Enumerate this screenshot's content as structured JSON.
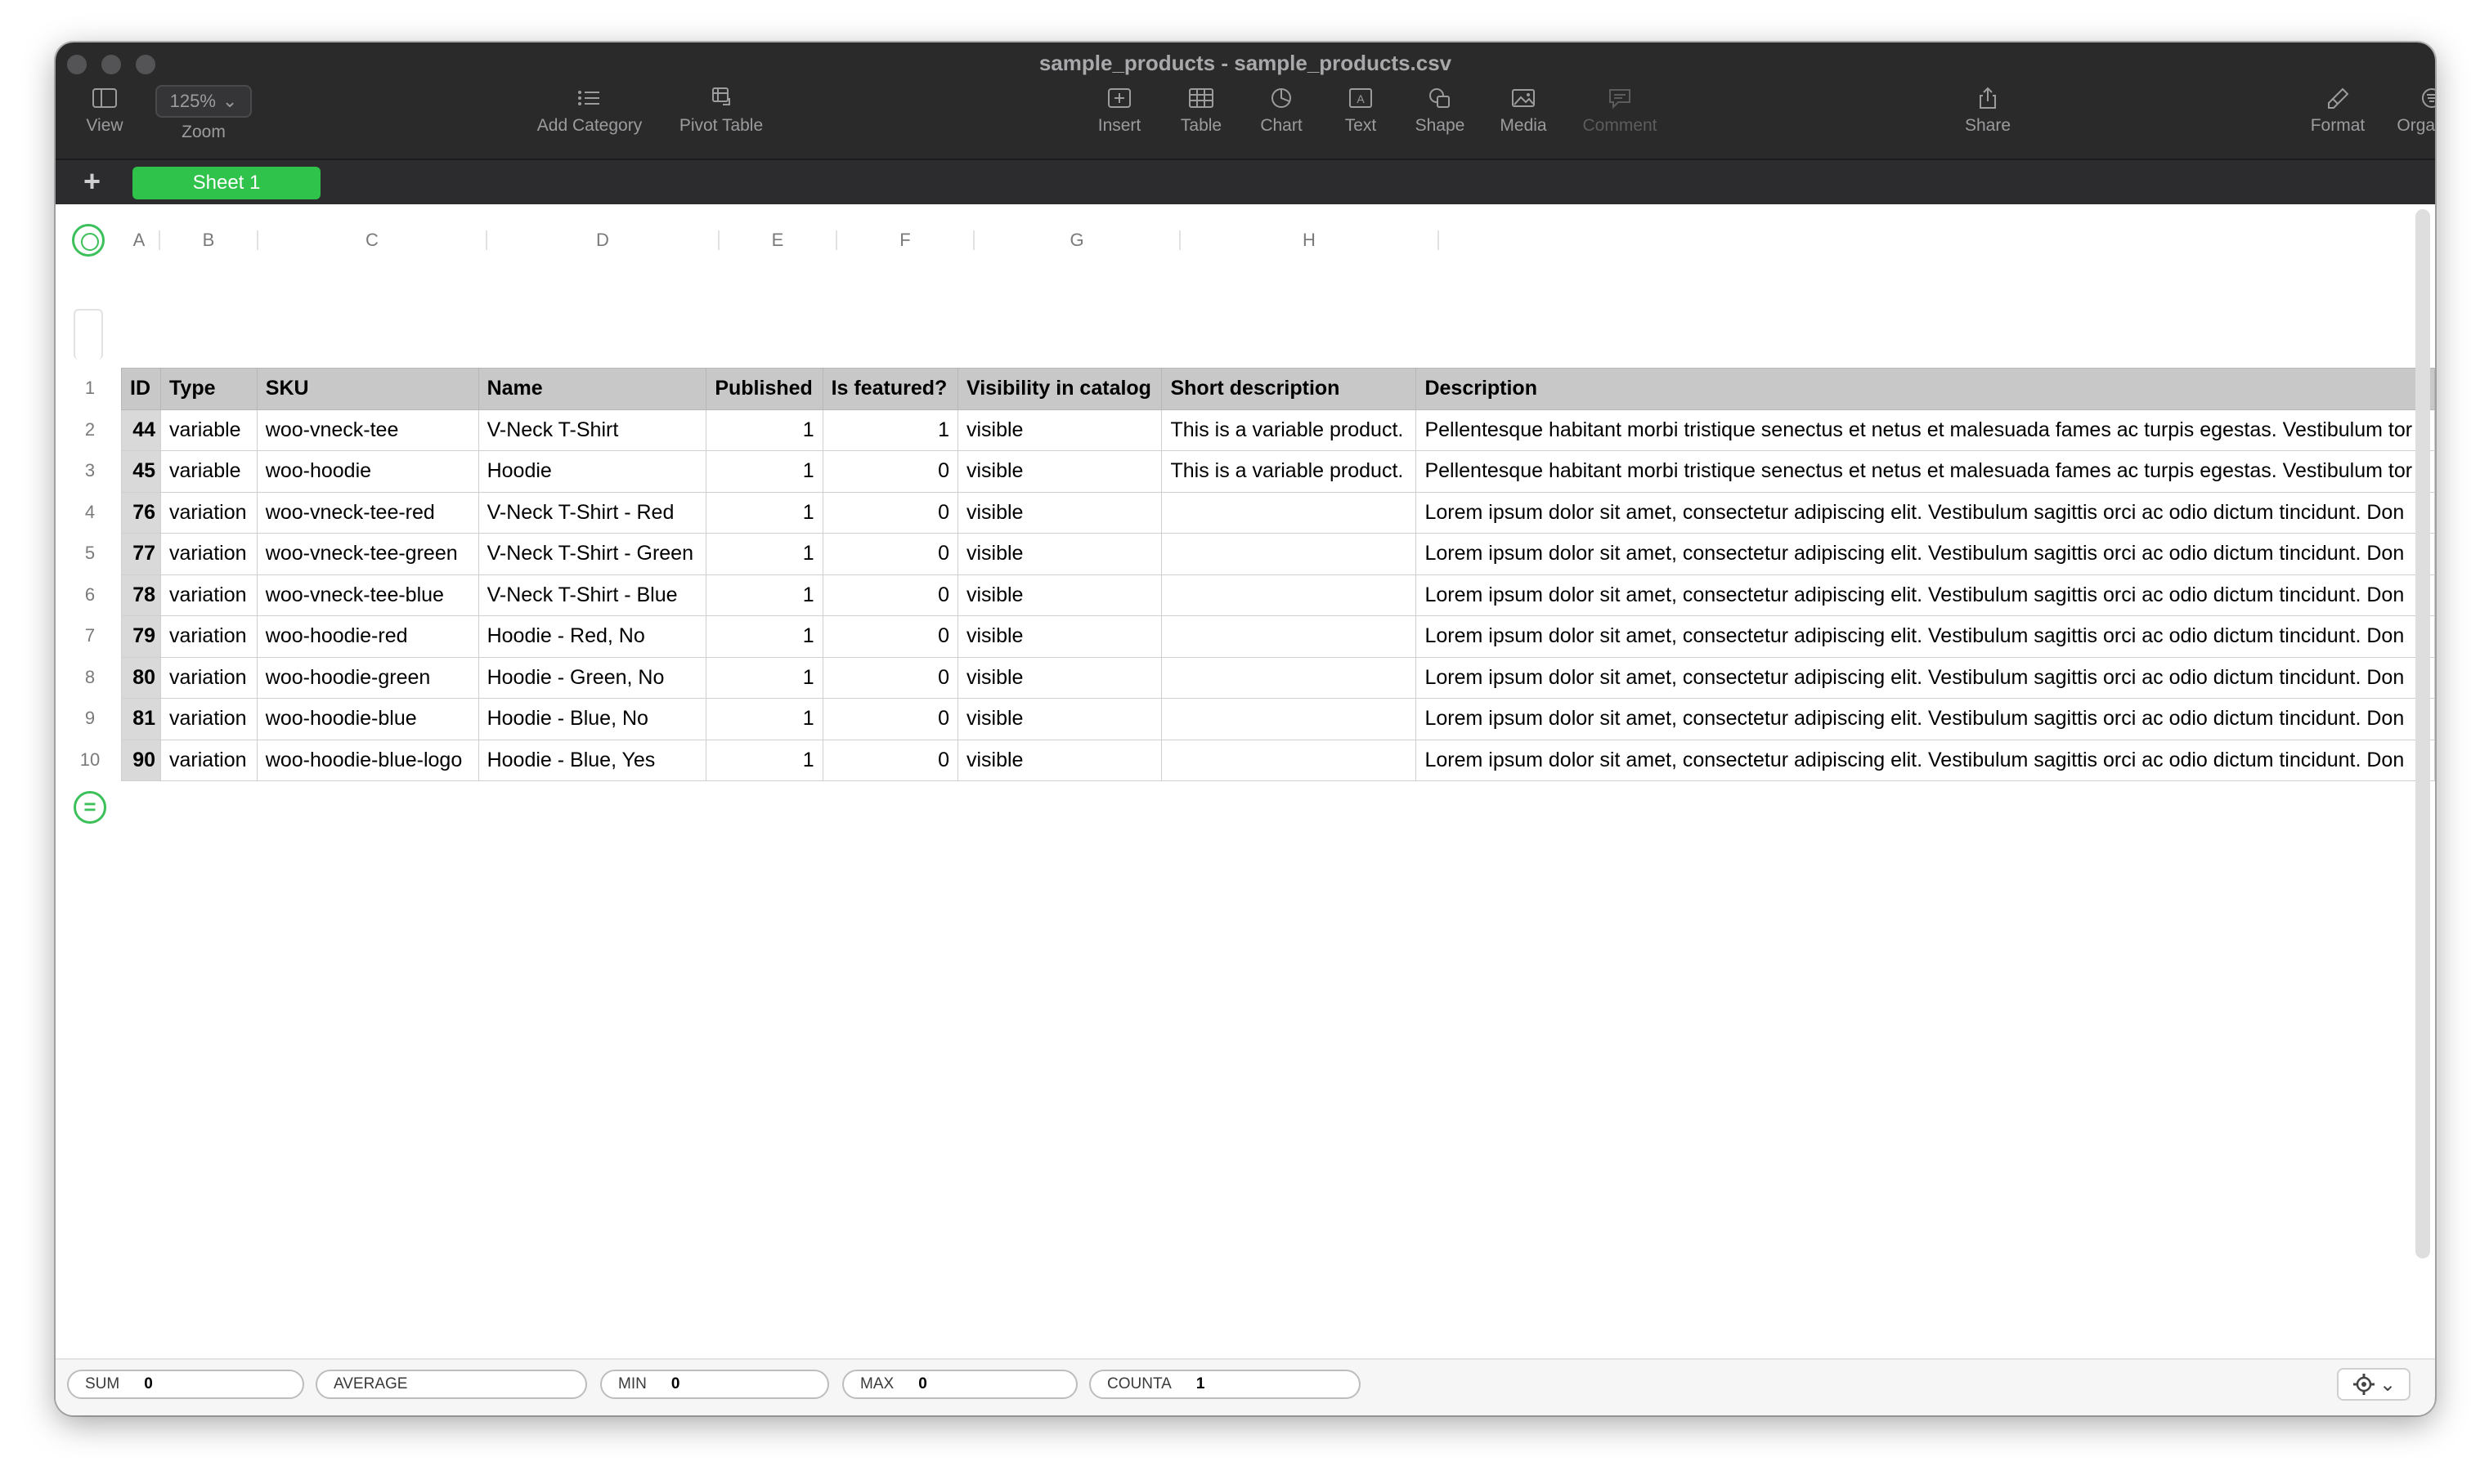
{
  "window": {
    "title": "sample_products - sample_products.csv"
  },
  "toolbar": {
    "view": "View",
    "zoom_value": "125%",
    "zoom": "Zoom",
    "add_category": "Add Category",
    "pivot_table": "Pivot Table",
    "insert": "Insert",
    "table": "Table",
    "chart": "Chart",
    "text": "Text",
    "shape": "Shape",
    "media": "Media",
    "comment": "Comment",
    "share": "Share",
    "format": "Format",
    "organize": "Organize"
  },
  "tabs": {
    "add": "+",
    "sheet1": "Sheet 1"
  },
  "columns": [
    "A",
    "B",
    "C",
    "D",
    "E",
    "F",
    "G",
    "H"
  ],
  "row_numbers": [
    "1",
    "2",
    "3",
    "4",
    "5",
    "6",
    "7",
    "8",
    "9",
    "10"
  ],
  "table": {
    "headers": [
      "ID",
      "Type",
      "SKU",
      "Name",
      "Published",
      "Is featured?",
      "Visibility in catalog",
      "Short description",
      "Description"
    ],
    "rows": [
      [
        "44",
        "variable",
        "woo-vneck-tee",
        "V-Neck T-Shirt",
        "1",
        "1",
        "visible",
        "This is a variable product.",
        "Pellentesque habitant morbi tristique senectus et netus et malesuada fames ac turpis egestas. Vestibulum tor"
      ],
      [
        "45",
        "variable",
        "woo-hoodie",
        "Hoodie",
        "1",
        "0",
        "visible",
        "This is a variable product.",
        "Pellentesque habitant morbi tristique senectus et netus et malesuada fames ac turpis egestas. Vestibulum tor"
      ],
      [
        "76",
        "variation",
        "woo-vneck-tee-red",
        "V-Neck T-Shirt - Red",
        "1",
        "0",
        "visible",
        "",
        "Lorem ipsum dolor sit amet, consectetur adipiscing elit. Vestibulum sagittis orci ac odio dictum tincidunt. Don"
      ],
      [
        "77",
        "variation",
        "woo-vneck-tee-green",
        "V-Neck T-Shirt - Green",
        "1",
        "0",
        "visible",
        "",
        "Lorem ipsum dolor sit amet, consectetur adipiscing elit. Vestibulum sagittis orci ac odio dictum tincidunt. Don"
      ],
      [
        "78",
        "variation",
        "woo-vneck-tee-blue",
        "V-Neck T-Shirt - Blue",
        "1",
        "0",
        "visible",
        "",
        "Lorem ipsum dolor sit amet, consectetur adipiscing elit. Vestibulum sagittis orci ac odio dictum tincidunt. Don"
      ],
      [
        "79",
        "variation",
        "woo-hoodie-red",
        "Hoodie - Red, No",
        "1",
        "0",
        "visible",
        "",
        "Lorem ipsum dolor sit amet, consectetur adipiscing elit. Vestibulum sagittis orci ac odio dictum tincidunt. Don"
      ],
      [
        "80",
        "variation",
        "woo-hoodie-green",
        "Hoodie - Green, No",
        "1",
        "0",
        "visible",
        "",
        "Lorem ipsum dolor sit amet, consectetur adipiscing elit. Vestibulum sagittis orci ac odio dictum tincidunt. Don"
      ],
      [
        "81",
        "variation",
        "woo-hoodie-blue",
        "Hoodie - Blue, No",
        "1",
        "0",
        "visible",
        "",
        "Lorem ipsum dolor sit amet, consectetur adipiscing elit. Vestibulum sagittis orci ac odio dictum tincidunt. Don"
      ],
      [
        "90",
        "variation",
        "woo-hoodie-blue-logo",
        "Hoodie - Blue, Yes",
        "1",
        "0",
        "visible",
        "",
        "Lorem ipsum dolor sit amet, consectetur adipiscing elit. Vestibulum sagittis orci ac odio dictum tincidunt. Don"
      ]
    ]
  },
  "add_row": "=",
  "status": {
    "sum_label": "SUM",
    "sum_value": "0",
    "average_label": "AVERAGE",
    "min_label": "MIN",
    "min_value": "0",
    "max_label": "MAX",
    "max_value": "0",
    "counta_label": "COUNTA",
    "counta_value": "1"
  }
}
